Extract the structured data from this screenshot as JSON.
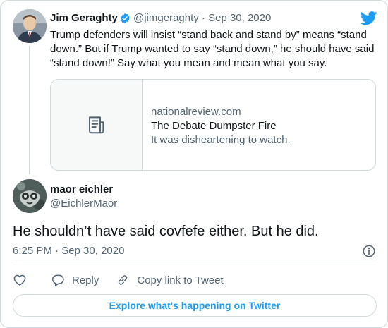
{
  "quoted_tweet": {
    "author_name": "Jim Geraghty",
    "author_handle_date": "@jimgeraghty · Sep 30, 2020",
    "text": "Trump defenders will insist “stand back and stand by” means “stand down.” But if Trump wanted to say “stand down,” he should have said “stand down!” Say what you mean and mean what you say.",
    "link_card": {
      "domain": "nationalreview.com",
      "title": "The Debate Dumpster Fire",
      "description": "It was disheartening to watch.",
      "thumbnail_icon": "article-icon"
    }
  },
  "reply_tweet": {
    "author_name": "maor eichler",
    "author_handle": "@EichlerMaor",
    "text": "He shouldn’t have said covfefe either. But he did.",
    "timestamp": "6:25 PM · Sep 30, 2020"
  },
  "actions": {
    "like_icon": "heart-icon",
    "reply_label": "Reply",
    "copy_label": "Copy link to Tweet"
  },
  "explore_label": "Explore what's happening on Twitter",
  "colors": {
    "accent": "#1d9bf0",
    "text": "#0f1419",
    "secondary": "#536471",
    "border": "#cfd9de"
  }
}
